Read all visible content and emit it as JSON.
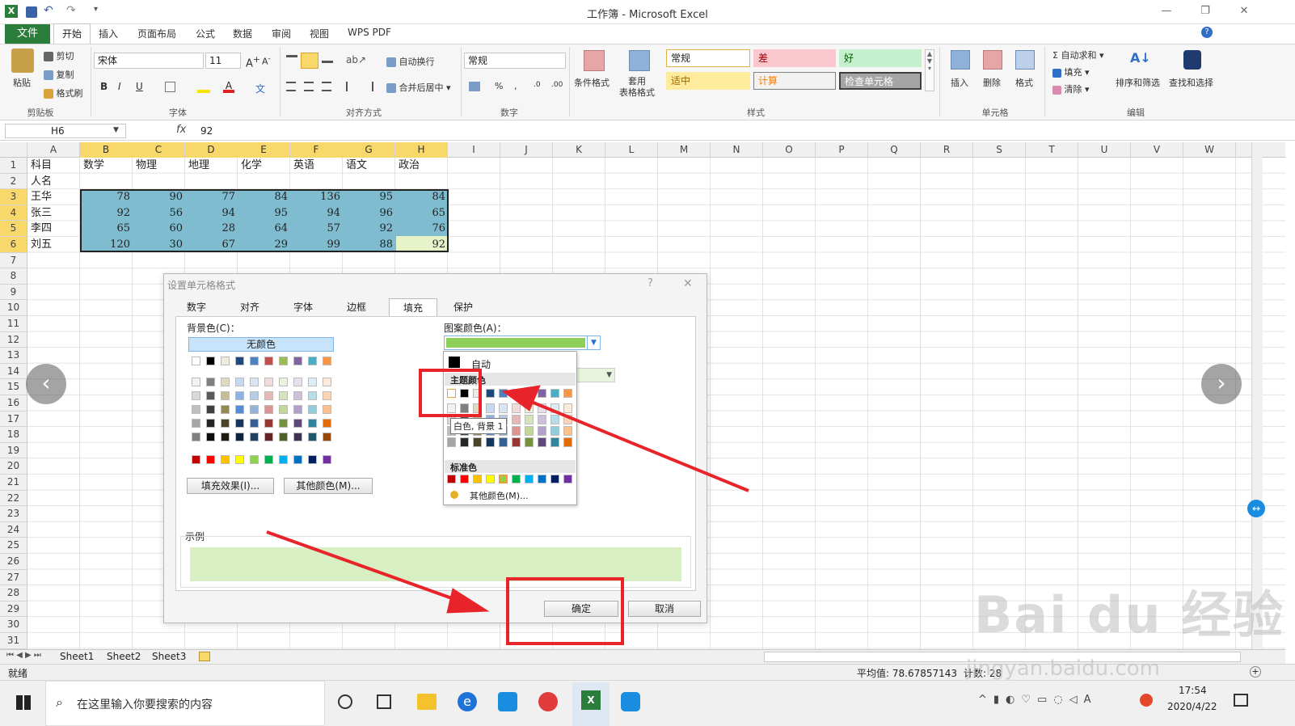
{
  "window": {
    "title": "工作簿 - Microsoft Excel"
  },
  "tabs": {
    "file": "文件",
    "home": "开始",
    "insert": "插入",
    "layout": "页面布局",
    "formulas": "公式",
    "data": "数据",
    "review": "审阅",
    "view": "视图",
    "wps": "WPS PDF"
  },
  "ribbon": {
    "clipboard": {
      "paste": "粘贴",
      "cut": "剪切",
      "copy": "复制",
      "painter": "格式刷",
      "label": "剪贴板"
    },
    "font": {
      "name": "宋体",
      "size": "11",
      "bold": "B",
      "italic": "I",
      "underline": "U",
      "label": "字体"
    },
    "align": {
      "wrap": "自动换行",
      "merge": "合并后居中",
      "label": "对齐方式"
    },
    "number": {
      "format": "常规",
      "label": "数字"
    },
    "styles": {
      "cond": "条件格式",
      "table1": "套用",
      "table2": "表格格式",
      "normal": "常规",
      "bad": "差",
      "good": "好",
      "neutral": "适中",
      "calc": "计算",
      "check": "检查单元格",
      "label": "样式"
    },
    "cells": {
      "insert": "插入",
      "delete": "删除",
      "format": "格式",
      "label": "单元格"
    },
    "edit": {
      "autosum": "自动求和",
      "fill": "填充",
      "clear": "清除",
      "sort": "排序和筛选",
      "find": "查找和选择",
      "label": "编辑"
    }
  },
  "formula_bar": {
    "name_box": "H6",
    "fx": "fx",
    "value": "92"
  },
  "columns": [
    "A",
    "B",
    "C",
    "D",
    "E",
    "F",
    "G",
    "H",
    "I",
    "J",
    "K",
    "L",
    "M",
    "N",
    "O",
    "P",
    "Q",
    "R",
    "S",
    "T",
    "U",
    "V",
    "W"
  ],
  "rows": [
    "1",
    "2",
    "3",
    "4",
    "5",
    "6",
    "7",
    "8",
    "9",
    "10",
    "11",
    "12",
    "13",
    "14",
    "15",
    "16",
    "17",
    "18",
    "19",
    "20",
    "21",
    "22",
    "23",
    "24",
    "25",
    "26",
    "27",
    "28",
    "29",
    "30",
    "31"
  ],
  "sheet": {
    "header": [
      "科目",
      "数学",
      "物理",
      "地理",
      "化学",
      "英语",
      "语文",
      "政治"
    ],
    "row2": "人名",
    "data": [
      {
        "name": "王华",
        "values": [
          "78",
          "90",
          "77",
          "84",
          "136",
          "95",
          "84"
        ]
      },
      {
        "name": "张三",
        "values": [
          "92",
          "56",
          "94",
          "95",
          "94",
          "96",
          "65"
        ]
      },
      {
        "name": "李四",
        "values": [
          "65",
          "60",
          "28",
          "64",
          "57",
          "92",
          "76"
        ]
      },
      {
        "name": "刘五",
        "values": [
          "120",
          "30",
          "67",
          "29",
          "99",
          "88",
          "92"
        ]
      }
    ]
  },
  "sheets": [
    "Sheet1",
    "Sheet2",
    "Sheet3"
  ],
  "status": {
    "ready": "就绪",
    "average": "平均值: 78.67857143",
    "count": "计数: 28"
  },
  "dialog": {
    "title": "设置单元格格式",
    "help": "?",
    "close": "✕",
    "tabs": [
      "数字",
      "对齐",
      "字体",
      "边框",
      "填充",
      "保护"
    ],
    "bg_label": "背景色(C)：",
    "no_color": "无颜色",
    "fill_effects": "填充效果(I)...",
    "more_colors": "其他颜色(M)...",
    "pattern_color_label": "图案颜色(A)：",
    "sample_label": "示例",
    "ok": "确定",
    "cancel": "取消"
  },
  "popup": {
    "auto": "自动",
    "theme": "主题颜色",
    "tooltip": "白色, 背景 1",
    "standard": "标准色",
    "more": "其他颜色(M)..."
  },
  "taskbar": {
    "search": "在这里输入你要搜索的内容",
    "time": "17:54",
    "date": "2020/4/22"
  },
  "watermark": {
    "brand": "Bai du 经验",
    "url": "jingyan.baidu.com"
  },
  "colors": {
    "selection": "#7fbcd0",
    "pattern_green": "#8ed05a",
    "sample_green": "#d8efc4",
    "arrow_red": "#e8242a",
    "excel_green": "#2a7d3a"
  }
}
